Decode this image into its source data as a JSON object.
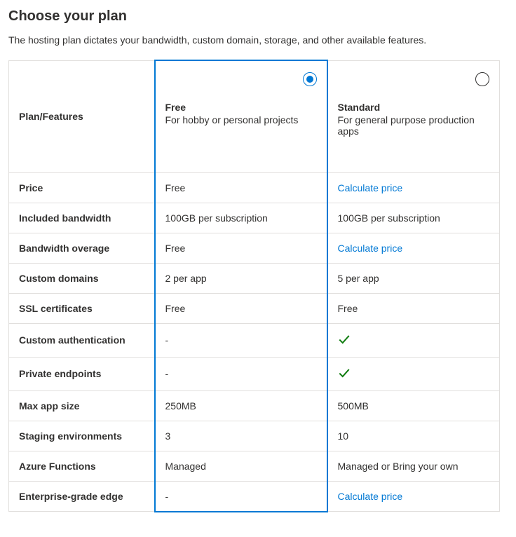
{
  "title": "Choose your plan",
  "subtitle": "The hosting plan dictates your bandwidth, custom domain, storage, and other available features.",
  "header_feature_label": "Plan/Features",
  "plans": {
    "free": {
      "name": "Free",
      "desc": "For hobby or personal projects",
      "selected": true
    },
    "standard": {
      "name": "Standard",
      "desc": "For general purpose production apps",
      "selected": false
    }
  },
  "labels": {
    "calculate_price": "Calculate price"
  },
  "rows": [
    {
      "label": "Price",
      "free": {
        "type": "text",
        "value": "Free"
      },
      "standard": {
        "type": "link",
        "value": "Calculate price"
      }
    },
    {
      "label": "Included bandwidth",
      "free": {
        "type": "text",
        "value": "100GB per subscription"
      },
      "standard": {
        "type": "text",
        "value": "100GB per subscription"
      }
    },
    {
      "label": "Bandwidth overage",
      "free": {
        "type": "text",
        "value": "Free"
      },
      "standard": {
        "type": "link",
        "value": "Calculate price"
      }
    },
    {
      "label": "Custom domains",
      "free": {
        "type": "text",
        "value": "2 per app"
      },
      "standard": {
        "type": "text",
        "value": "5 per app"
      }
    },
    {
      "label": "SSL certificates",
      "free": {
        "type": "text",
        "value": "Free"
      },
      "standard": {
        "type": "text",
        "value": "Free"
      }
    },
    {
      "label": "Custom authentication",
      "free": {
        "type": "text",
        "value": "-"
      },
      "standard": {
        "type": "check"
      }
    },
    {
      "label": "Private endpoints",
      "free": {
        "type": "text",
        "value": "-"
      },
      "standard": {
        "type": "check"
      }
    },
    {
      "label": "Max app size",
      "free": {
        "type": "text",
        "value": "250MB"
      },
      "standard": {
        "type": "text",
        "value": "500MB"
      }
    },
    {
      "label": "Staging environments",
      "free": {
        "type": "text",
        "value": "3"
      },
      "standard": {
        "type": "text",
        "value": "10"
      }
    },
    {
      "label": "Azure Functions",
      "free": {
        "type": "text",
        "value": "Managed"
      },
      "standard": {
        "type": "text",
        "value": "Managed or Bring your own"
      }
    },
    {
      "label": "Enterprise-grade edge",
      "free": {
        "type": "text",
        "value": "-"
      },
      "standard": {
        "type": "link",
        "value": "Calculate price"
      }
    }
  ]
}
